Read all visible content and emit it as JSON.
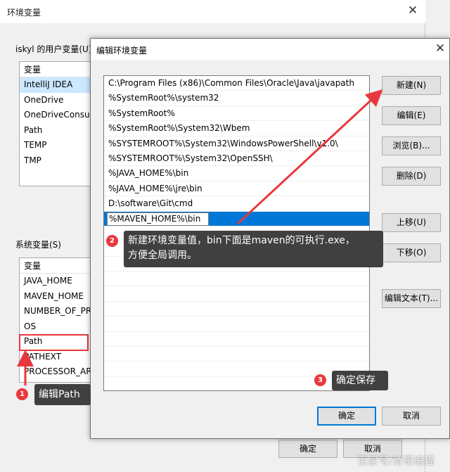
{
  "bg_window": {
    "title": "环境变量",
    "close_glyph": "✕",
    "user_group_label": "iskyl 的用户变量(U)",
    "user_header": "变量",
    "user_vars": [
      "IntelliJ IDEA",
      "OneDrive",
      "OneDriveConsum",
      "Path",
      "TEMP",
      "TMP"
    ],
    "system_group_label": "系统变量(S)",
    "system_header": "变量",
    "system_vars": [
      "JAVA_HOME",
      "MAVEN_HOME",
      "NUMBER_OF_PR",
      "OS",
      "Path",
      "PATHEXT",
      "PROCESSOR_ARC"
    ],
    "ok_label": "确定",
    "cancel_label": "取消"
  },
  "dialog": {
    "title": "编辑环境变量",
    "close_glyph": "✕",
    "paths": [
      "C:\\Program Files (x86)\\Common Files\\Oracle\\Java\\javapath",
      "%SystemRoot%\\system32",
      "%SystemRoot%",
      "%SystemRoot%\\System32\\Wbem",
      "%SYSTEMROOT%\\System32\\WindowsPowerShell\\v1.0\\",
      "%SYSTEMROOT%\\System32\\OpenSSH\\",
      "%JAVA_HOME%\\bin",
      "%JAVA_HOME%\\jre\\bin",
      "D:\\software\\Git\\cmd"
    ],
    "editing_value": "%MAVEN_HOME%\\bin",
    "buttons": {
      "new": "新建(N)",
      "edit": "编辑(E)",
      "browse": "浏览(B)...",
      "delete": "删除(D)",
      "move_up": "上移(U)",
      "move_down": "下移(O)",
      "edit_text": "编辑文本(T)...",
      "ok": "确定",
      "cancel": "取消"
    }
  },
  "annotations": {
    "step1": {
      "number": "1",
      "text": "编辑Path"
    },
    "step2": {
      "number": "2",
      "line1": "新建环境变量值，bin下面是maven的可执行.exe，",
      "line2": "方便全局调用。"
    },
    "step3": {
      "number": "3",
      "text": "确定保存"
    },
    "accent_color": "#e8383d"
  },
  "watermark": "百家号/诗哥编程"
}
